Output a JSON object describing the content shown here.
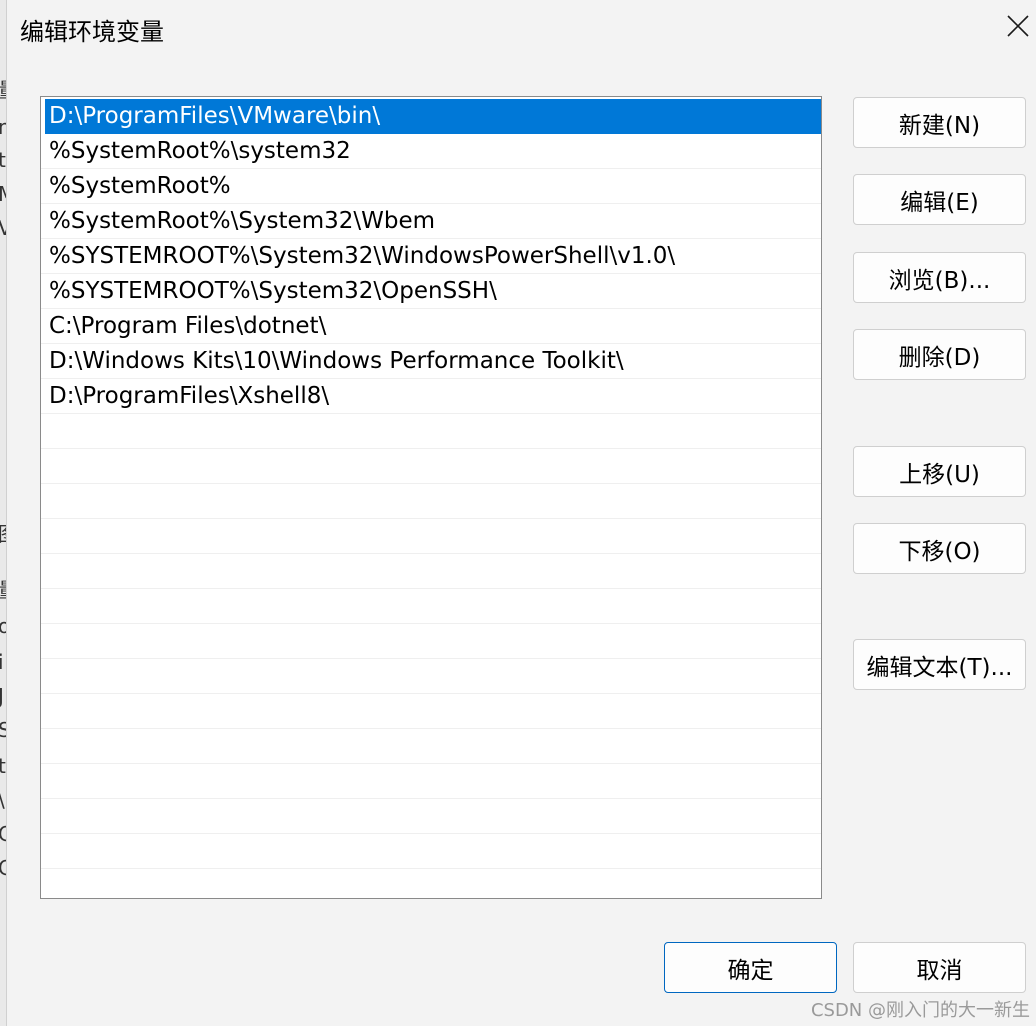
{
  "window": {
    "title": "编辑环境变量"
  },
  "path_list": {
    "items": [
      "D:\\ProgramFiles\\VMware\\bin\\",
      "%SystemRoot%\\system32",
      "%SystemRoot%",
      "%SystemRoot%\\System32\\Wbem",
      "%SYSTEMROOT%\\System32\\WindowsPowerShell\\v1.0\\",
      "%SYSTEMROOT%\\System32\\OpenSSH\\",
      "C:\\Program Files\\dotnet\\",
      "D:\\Windows Kits\\10\\Windows Performance Toolkit\\",
      "D:\\ProgramFiles\\Xshell8\\"
    ],
    "selected_index": 0
  },
  "side_buttons": {
    "new": "新建(N)",
    "edit": "编辑(E)",
    "browse": "浏览(B)...",
    "delete": "删除(D)",
    "move_up": "上移(U)",
    "move_down": "下移(O)",
    "edit_text": "编辑文本(T)..."
  },
  "footer": {
    "ok": "确定",
    "cancel": "取消"
  },
  "watermark": "CSDN @刚入门的大一新生",
  "colors": {
    "selection": "#0078d7",
    "primary_border": "#0067c0"
  },
  "background_window_glyphs": [
    "量",
    "n",
    "t",
    "M",
    "V",
    "图",
    "量",
    "o",
    "i",
    "J",
    "S",
    "t",
    "\\",
    "C",
    "C"
  ]
}
